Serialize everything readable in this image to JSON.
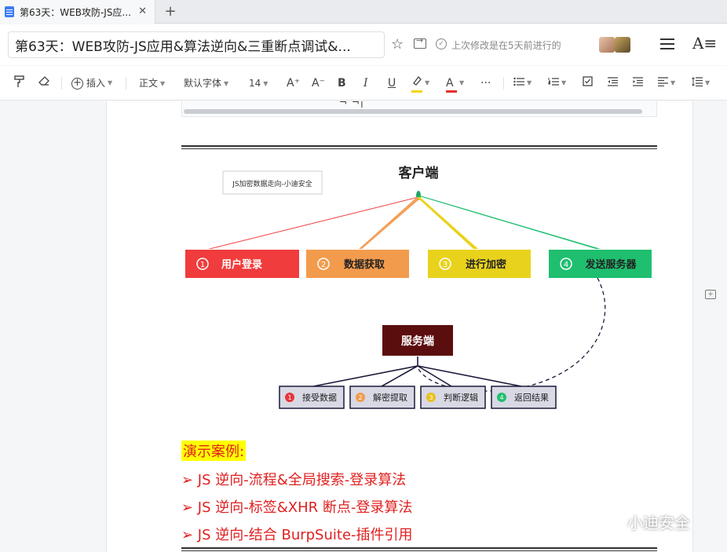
{
  "tab": {
    "title": "第63天：WEB攻防-JS应...",
    "close": "✕",
    "new_tab": "+"
  },
  "titlebar": {
    "title": "第63天：WEB攻防-JS应用&算法逆向&三重断点调试&...",
    "saved_status": "上次修改是在5天前进行的",
    "font_panel": "A≡"
  },
  "toolbar": {
    "insert_label": "插入",
    "style_label": "正文",
    "font_label": "默认字体",
    "size_label": "14",
    "bold": "B",
    "italic": "I",
    "underline": "U",
    "font_color": "A",
    "more": "···",
    "grow": "A⁺",
    "shrink": "A⁻",
    "highlight_color": "#f1d500",
    "text_color": "#e5322b"
  },
  "code_block": {
    "cut_text": "¬ ¬|"
  },
  "diagram": {
    "watermark_label": "JS加密数据走向-小迪安全",
    "client_label": "客户端",
    "steps": [
      {
        "num": "1",
        "label": "用户登录",
        "color": "#f03c3c"
      },
      {
        "num": "2",
        "label": "数据获取",
        "color": "#f39b4c"
      },
      {
        "num": "3",
        "label": "进行加密",
        "color": "#e9d21c"
      },
      {
        "num": "4",
        "label": "发送服务器",
        "color": "#1fbf6f"
      }
    ],
    "server_label": "服务端",
    "server_color": "#5b0e0e",
    "server_steps": [
      {
        "num": "1",
        "label": "接受数据",
        "color": "#e8343a"
      },
      {
        "num": "2",
        "label": "解密提取",
        "color": "#f39b4c"
      },
      {
        "num": "3",
        "label": "判断逻辑",
        "color": "#e9c01c"
      },
      {
        "num": "4",
        "label": "返回结果",
        "color": "#1fbf6f"
      }
    ]
  },
  "content": {
    "case_title": "演示案例:",
    "items": [
      "➢ JS 逆向-流程&全局搜索-登录算法",
      "➢ JS 逆向-标签&XHR 断点-登录算法",
      "➢ JS 逆向-结合 BurpSuite-插件引用"
    ]
  },
  "watermark": {
    "text": "小迪安全"
  }
}
